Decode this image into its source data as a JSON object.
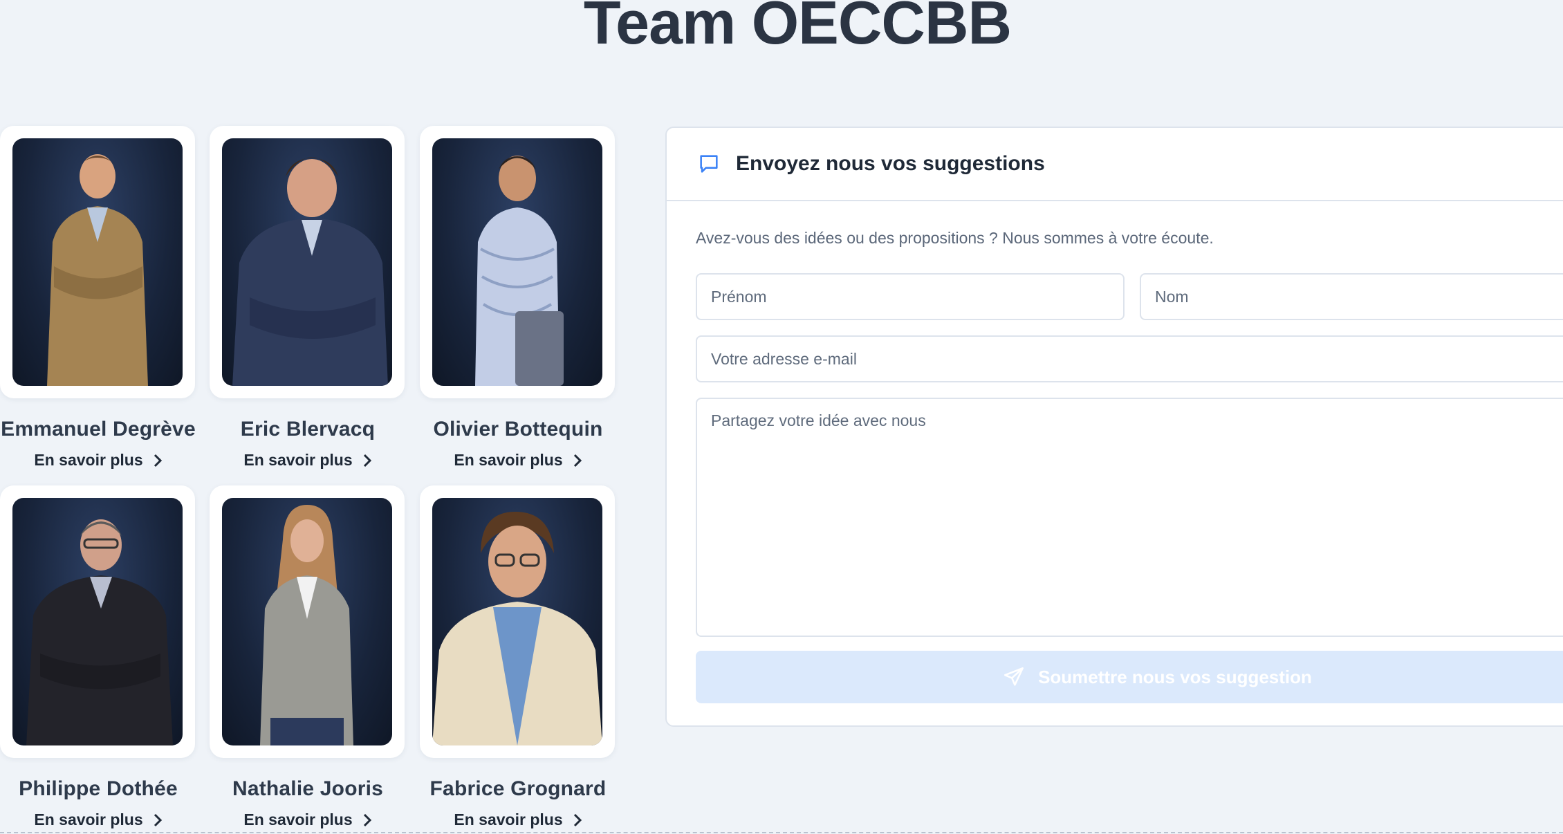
{
  "page": {
    "title": "Team OECCBB"
  },
  "team": {
    "members": [
      {
        "name": "Emmanuel Degrève",
        "link": "En savoir plus"
      },
      {
        "name": "Eric Blervacq",
        "link": "En savoir plus"
      },
      {
        "name": "Olivier Bottequin",
        "link": "En savoir plus"
      },
      {
        "name": "Philippe Dothée",
        "link": "En savoir plus"
      },
      {
        "name": "Nathalie Jooris",
        "link": "En savoir plus"
      },
      {
        "name": "Fabrice Grognard",
        "link": "En savoir plus"
      }
    ]
  },
  "suggestions": {
    "title": "Envoyez nous vos suggestions",
    "subtitle": "Avez-vous des idées ou des propositions ? Nous sommes à votre écoute.",
    "firstname_placeholder": "Prénom",
    "lastname_placeholder": "Nom",
    "email_placeholder": "Votre adresse e-mail",
    "message_placeholder": "Partagez votre idée avec nous",
    "submit_label": "Soumettre nous vos suggestion",
    "icons": {
      "header": "chat-bubble-icon",
      "submit": "send-icon"
    },
    "colors": {
      "accent": "#3b82f6",
      "submit_disabled_bg": "#dbe9fc"
    }
  }
}
